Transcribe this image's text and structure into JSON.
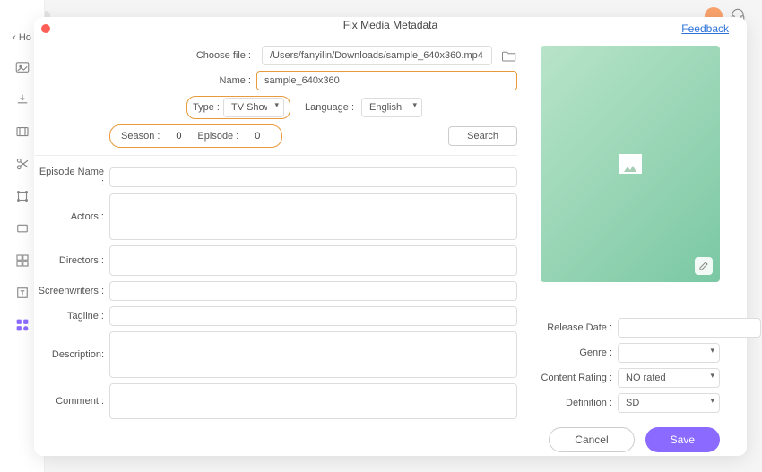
{
  "window": {
    "back": "‹ Ho"
  },
  "modal": {
    "title": "Fix Media Metadata",
    "feedback": "Feedback"
  },
  "fields": {
    "choose_file_label": "Choose file :",
    "choose_file_value": "/Users/fanyilin/Downloads/sample_640x360.mp4",
    "name_label": "Name :",
    "name_value": "sample_640x360",
    "type_label": "Type :",
    "type_value": "TV Shows",
    "language_label": "Language :",
    "language_value": "English",
    "season_label": "Season :",
    "season_value": "0",
    "episode_label": "Episode :",
    "episode_value": "0",
    "search_label": "Search",
    "episode_name_label": "Episode Name :",
    "actors_label": "Actors :",
    "directors_label": "Directors :",
    "screenwriters_label": "Screenwriters :",
    "tagline_label": "Tagline :",
    "description_label": "Description:",
    "comment_label": "Comment :",
    "release_date_label": "Release Date :",
    "genre_label": "Genre :",
    "content_rating_label": "Content Rating :",
    "content_rating_value": "NO rated",
    "definition_label": "Definition :",
    "definition_value": "SD"
  },
  "buttons": {
    "cancel": "Cancel",
    "save": "Save"
  }
}
